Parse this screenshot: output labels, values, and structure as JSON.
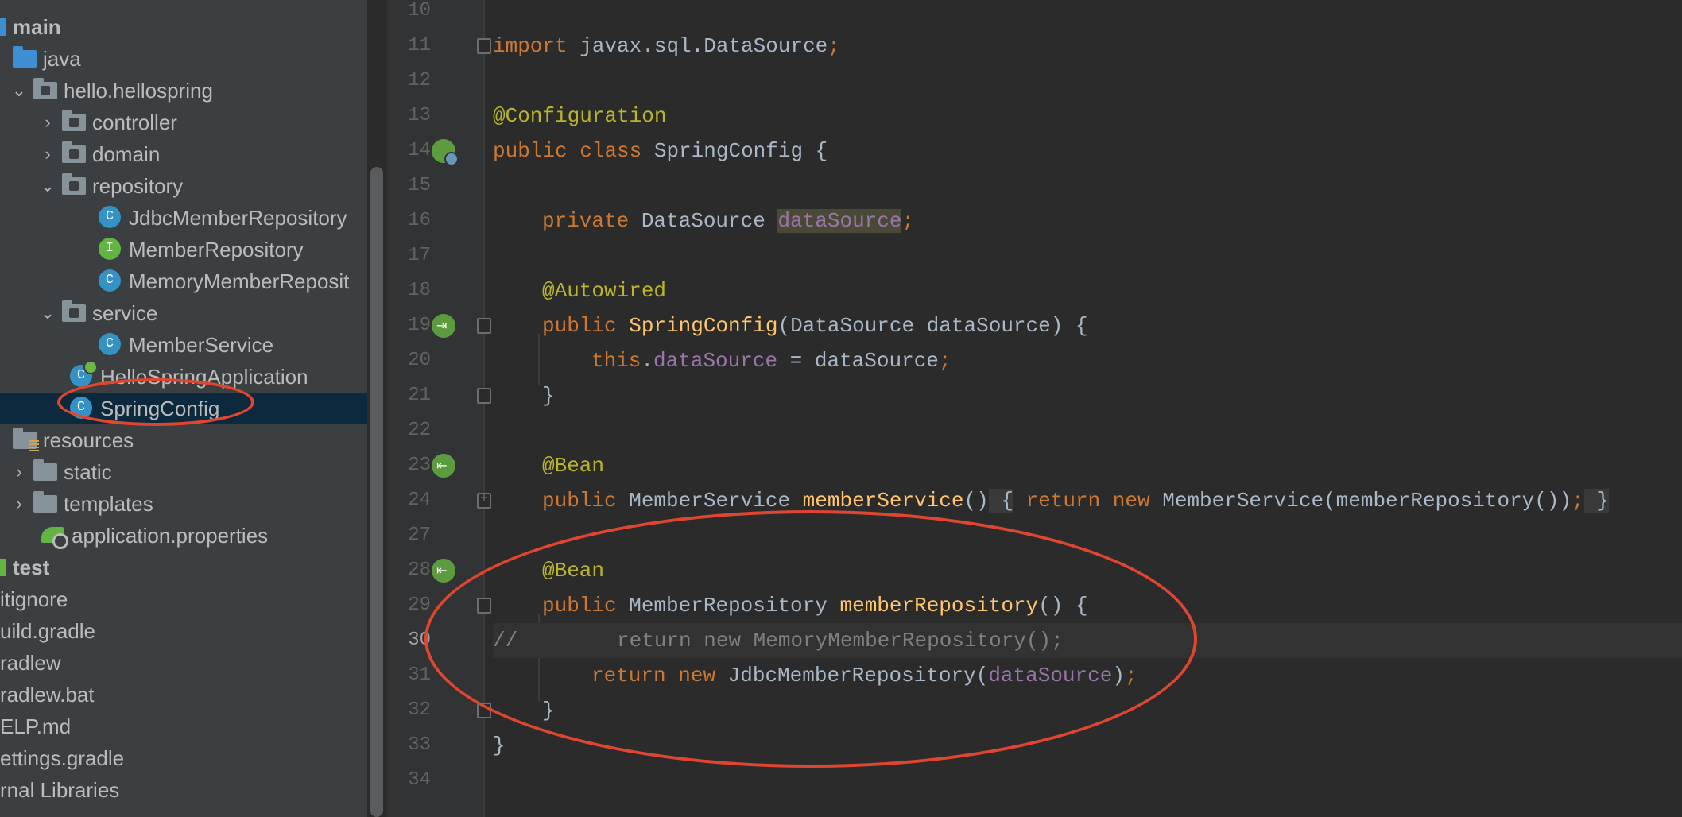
{
  "project_tree": {
    "items": [
      {
        "label": "main"
      },
      {
        "label": "java"
      },
      {
        "label": "hello.hellospring"
      },
      {
        "label": "controller"
      },
      {
        "label": "domain"
      },
      {
        "label": "repository"
      },
      {
        "label": "JdbcMemberRepository",
        "icon_letter": "C"
      },
      {
        "label": "MemberRepository",
        "icon_letter": "I"
      },
      {
        "label": "MemoryMemberReposit",
        "icon_letter": "C"
      },
      {
        "label": "service"
      },
      {
        "label": "MemberService",
        "icon_letter": "C"
      },
      {
        "label": "HelloSpringApplication",
        "icon_letter": "C"
      },
      {
        "label": "SpringConfig",
        "icon_letter": "C"
      },
      {
        "label": "resources"
      },
      {
        "label": "static"
      },
      {
        "label": "templates"
      },
      {
        "label": "application.properties"
      },
      {
        "label": "test"
      },
      {
        "label": "itignore"
      },
      {
        "label": "uild.gradle"
      },
      {
        "label": "radlew"
      },
      {
        "label": "radlew.bat"
      },
      {
        "label": "ELP.md"
      },
      {
        "label": "ettings.gradle"
      },
      {
        "label": "rnal Libraries"
      }
    ],
    "selected": "SpringConfig"
  },
  "editor": {
    "current_line": "30",
    "line_numbers": [
      "10",
      "11",
      "12",
      "13",
      "14",
      "15",
      "16",
      "17",
      "18",
      "19",
      "20",
      "21",
      "22",
      "23",
      "24",
      "27",
      "28",
      "29",
      "30",
      "31",
      "32",
      "33",
      "34"
    ],
    "t": {
      "import": "import",
      "import_rest": " javax.sql.DataSource",
      "semi": ";",
      "annot_configuration": "@Configuration",
      "public": "public",
      "class": "class",
      "class_decl_rest": " SpringConfig {",
      "private": "private",
      "datasource_type": " DataSource ",
      "datasource_field": "dataSource",
      "annot_autowired": "@Autowired",
      "ctor_name": "SpringConfig",
      "ctor_params": "(DataSource dataSource) {",
      "this": "this",
      "dot": ".",
      "assign_rest": " = dataSource",
      "close_brace": "}",
      "annot_bean": "@Bean",
      "memberservice_type": " MemberService ",
      "memberservice_method": "memberService",
      "parens": "()",
      "open_brace_folded": " {",
      "return": "return",
      "new": "new",
      "memberservice_ctor": " MemberService(memberRepository())",
      "close_brace_folded": " }",
      "memberrepository_type": " MemberRepository ",
      "memberrepository_method": "memberRepository",
      "method_open": "() {",
      "comment_line": "//        return new MemoryMemberRepository();",
      "jdbc_new": " JdbcMemberRepository(",
      "close_paren": ")"
    }
  },
  "colors": {
    "annotation_oval": "#e0462f",
    "keyword": "#cc7832",
    "annotation": "#bbb529",
    "field": "#9876aa",
    "method": "#ffc66d"
  }
}
